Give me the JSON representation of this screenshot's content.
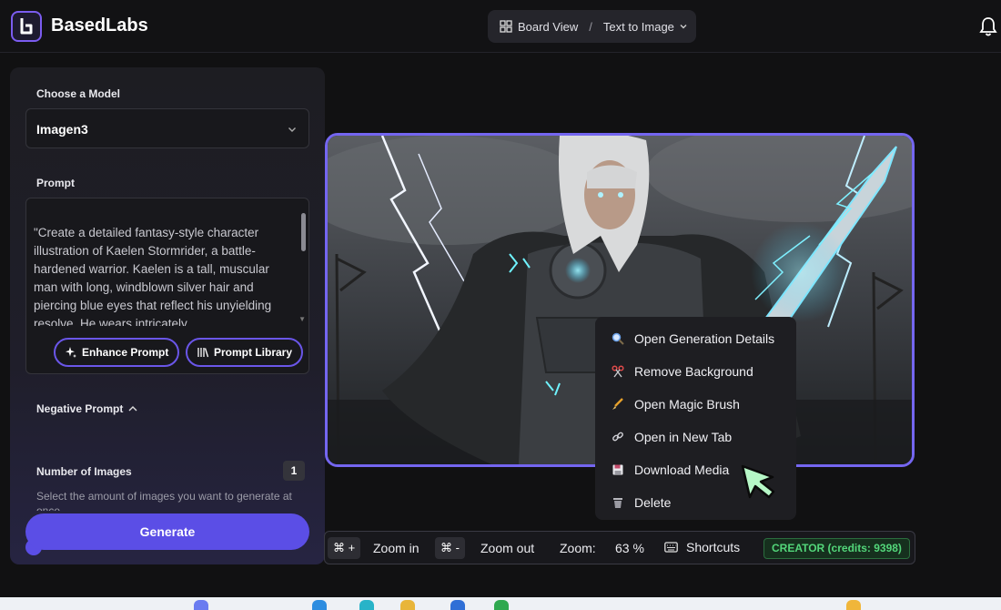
{
  "header": {
    "brand": "BasedLabs",
    "breadcrumb_board": "Board View",
    "breadcrumb_sep": "/",
    "breadcrumb_current": "Text to Image"
  },
  "panel": {
    "model_label": "Choose a Model",
    "model_value": "Imagen3",
    "prompt_label": "Prompt",
    "prompt_text": "\"Create a detailed fantasy-style character illustration of Kaelen Stormrider, a battle-hardened warrior. Kaelen is a tall, muscular man with long, windblown silver hair and piercing blue eyes that reflect his unyielding resolve. He wears intricately",
    "enhance_label": "Enhance Prompt",
    "library_label": "Prompt Library",
    "negative_label": "Negative Prompt",
    "num_images_label": "Number of Images",
    "num_images_value": "1",
    "num_images_desc": "Select the amount of images you want to generate at once.",
    "generate_label": "Generate"
  },
  "context_menu": [
    {
      "label": "Open Generation Details",
      "icon": "magnifier-icon"
    },
    {
      "label": "Remove Background",
      "icon": "scissors-icon"
    },
    {
      "label": "Open Magic Brush",
      "icon": "brush-icon"
    },
    {
      "label": "Open in New Tab",
      "icon": "link-icon"
    },
    {
      "label": "Download Media",
      "icon": "floppy-icon"
    },
    {
      "label": "Delete",
      "icon": "trash-icon"
    }
  ],
  "bottombar": {
    "zoom_in_key": "⌘ +",
    "zoom_in_label": "Zoom in",
    "zoom_out_key": "⌘ -",
    "zoom_out_label": "Zoom out",
    "zoom_label": "Zoom:",
    "zoom_value": "63 %",
    "shortcuts_label": "Shortcuts",
    "credits": "CREATOR (credits: 9398)"
  },
  "colors": {
    "accent": "#5b4ee6",
    "frame": "#7466f0",
    "credits_green": "#53d67a"
  }
}
